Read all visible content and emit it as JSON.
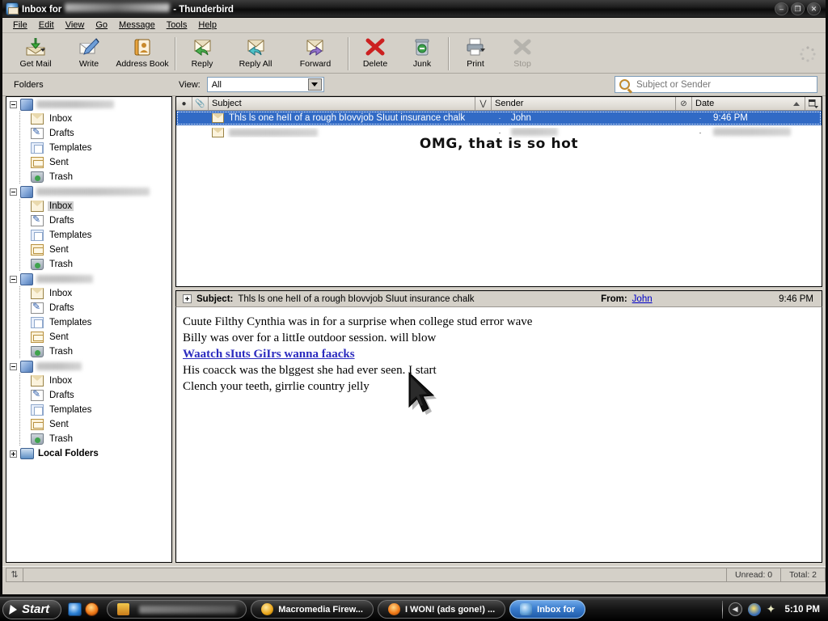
{
  "window": {
    "title_prefix": "Inbox for",
    "title_suffix": "- Thunderbird",
    "minimize": "–",
    "restore": "❐",
    "close": "✕"
  },
  "menubar": [
    {
      "label": "File"
    },
    {
      "label": "Edit"
    },
    {
      "label": "View"
    },
    {
      "label": "Go"
    },
    {
      "label": "Message"
    },
    {
      "label": "Tools"
    },
    {
      "label": "Help"
    }
  ],
  "toolbar": [
    {
      "label": "Get Mail",
      "icon": "get-mail-icon",
      "dropdown": true,
      "disabled": false
    },
    {
      "label": "Write",
      "icon": "write-icon",
      "dropdown": false,
      "disabled": false
    },
    {
      "label": "Address Book",
      "icon": "address-book-icon",
      "dropdown": false,
      "disabled": false
    },
    {
      "label": "Reply",
      "icon": "reply-icon",
      "dropdown": false,
      "disabled": false
    },
    {
      "label": "Reply All",
      "icon": "reply-all-icon",
      "dropdown": false,
      "disabled": false
    },
    {
      "label": "Forward",
      "icon": "forward-icon",
      "dropdown": false,
      "disabled": false
    },
    {
      "label": "Delete",
      "icon": "delete-icon",
      "dropdown": false,
      "disabled": false
    },
    {
      "label": "Junk",
      "icon": "junk-icon",
      "dropdown": false,
      "disabled": false
    },
    {
      "label": "Print",
      "icon": "print-icon",
      "dropdown": true,
      "disabled": false
    },
    {
      "label": "Stop",
      "icon": "stop-icon",
      "dropdown": false,
      "disabled": true
    }
  ],
  "viewbar": {
    "folders_label": "Folders",
    "view_label": "View:",
    "view_value": "All",
    "view_options": [
      "All"
    ]
  },
  "search": {
    "placeholder": "Subject or Sender",
    "value": "",
    "icon": "search-icon"
  },
  "folder_pane": {
    "accounts": [
      {
        "name_blurred": true,
        "blur_width": 96,
        "folders": [
          "Inbox",
          "Drafts",
          "Templates",
          "Sent",
          "Trash"
        ],
        "selected": null
      },
      {
        "name_blurred": true,
        "blur_width": 140,
        "folders": [
          "Inbox",
          "Drafts",
          "Templates",
          "Sent",
          "Trash"
        ],
        "selected": "Inbox"
      },
      {
        "name_blurred": true,
        "blur_width": 70,
        "folders": [
          "Inbox",
          "Drafts",
          "Templates",
          "Sent",
          "Trash"
        ],
        "selected": null
      },
      {
        "name_blurred": true,
        "blur_width": 56,
        "folders": [
          "Inbox",
          "Drafts",
          "Templates",
          "Sent",
          "Trash"
        ],
        "selected": null
      }
    ],
    "local_folders_label": "Local Folders"
  },
  "message_list": {
    "columns": [
      {
        "label": "",
        "name": "read-status-column",
        "glyph": "▼"
      },
      {
        "label": "",
        "name": "attachment-column",
        "glyph": "\u0001"
      },
      {
        "label": "Subject",
        "name": "subject-column"
      },
      {
        "label": "",
        "name": "thread-column",
        "glyph": "⋁"
      },
      {
        "label": "Sender",
        "name": "sender-column"
      },
      {
        "label": "",
        "name": "junk-status-column",
        "glyph": "⊘"
      },
      {
        "label": "Date",
        "name": "date-column",
        "sorted": true
      },
      {
        "label": "",
        "name": "column-picker",
        "glyph": "☰"
      }
    ],
    "rows": [
      {
        "subject": "Thls ls one heII of a rough bIovvjob SIuut insurance chalk",
        "sender": "John",
        "date": "9:46 PM",
        "selected": true,
        "blurred": false
      },
      {
        "subject": "",
        "sender": "",
        "date": "",
        "selected": false,
        "blurred": true,
        "subject_blur_width": 110,
        "sender_blur_width": 58,
        "date_blur_width": 96
      }
    ],
    "overlay_text": "OMG, that is so hot"
  },
  "message_header": {
    "subject_label": "Subject:",
    "subject_value": "Thls ls one heII of a rough bIovvjob SIuut insurance chalk",
    "from_label": "From:",
    "from_value": "John",
    "time": "9:46 PM"
  },
  "message_body": {
    "lines": [
      {
        "text": "Cuute Filthy Cynthia was in for a surprise when college stud error wave",
        "link": false
      },
      {
        "text": "Billy was over for a littIe outdoor session. will blow",
        "link": false
      },
      {
        "text": "Waatch sIuts GiIrs wanna faacks",
        "link": true
      },
      {
        "text": "His coacck was the blggest she had ever seen. I start",
        "link": false
      },
      {
        "text": "Clench your teeth, girrlie country jelly",
        "link": false
      }
    ]
  },
  "statusbar": {
    "online_icon": "offline-indicator-icon",
    "unread": "Unread: 0",
    "total": "Total: 2"
  },
  "taskbar": {
    "start_label": "Start",
    "quick_launch": [
      "internet-explorer-icon",
      "firefox-icon"
    ],
    "buttons": [
      {
        "label": "",
        "icon": "acrobat-icon",
        "active": false,
        "blurred": true,
        "blur_width": 120
      },
      {
        "label": "Macromedia Firew...",
        "icon": "fireworks-icon",
        "active": false,
        "blurred": false
      },
      {
        "label": "I WON! (ads gone!) ...",
        "icon": "firefox-icon",
        "active": false,
        "blurred": false
      },
      {
        "label": "Inbox for",
        "icon": "thunderbird-icon",
        "active": true,
        "blurred": false,
        "blur_width": 72
      }
    ],
    "tray": {
      "chevron": "◀",
      "icons": [
        "running-man-icon",
        "sparkle-icon"
      ],
      "clock": "5:10 PM"
    }
  }
}
